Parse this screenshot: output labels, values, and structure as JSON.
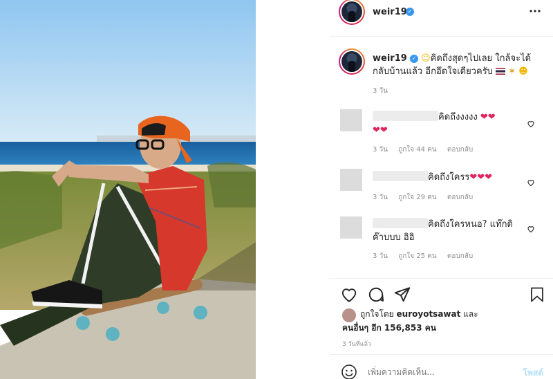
{
  "post": {
    "author": "weir19",
    "caption": "คิดถึงสุดๆไปเลย ใกล้จะได้",
    "caption_line2": "กลับบ้านแล้ว อีกอึดใจเดียวครับ",
    "caption_age": "3 วัน",
    "likes_prefix": "ถูกใจโดย",
    "liked_by_user": "euroyotsawat",
    "likes_and": "และ",
    "likes_count_text": "คนอื่นๆ อีก 156,853 คน",
    "post_age": "3 วันที่แล้ว"
  },
  "comments": [
    {
      "text_line1": "คิดถึงงงงง",
      "time": "3 วัน",
      "likes": "ถูกใจ 44 คน",
      "reply": "ตอบกลับ"
    },
    {
      "text_line1": "คิดถึงใครร",
      "time": "3 วัน",
      "likes": "ถูกใจ 29 คน",
      "reply": "ตอบกลับ"
    },
    {
      "text_line1": "คิดถึงใครหนอ? แท๊กดิ",
      "text_line2": "ค๊าบบบ อิอิ",
      "time": "3 วัน",
      "likes": "ถูกใจ 25 คน",
      "reply": "ตอบกลับ"
    }
  ],
  "add_comment": {
    "placeholder": "เพิ่มความคิดเห็น...",
    "post_label": "โพสต์"
  },
  "icons": [
    "more-options-icon",
    "heart-icon",
    "comment-icon",
    "share-icon",
    "save-icon",
    "emoji-icon",
    "verified-icon"
  ],
  "colors": {
    "verified": "#3897f0",
    "heart_red": "#e0245e",
    "post_button": "#b2dffc",
    "muted_text": "#8e8e8e"
  }
}
